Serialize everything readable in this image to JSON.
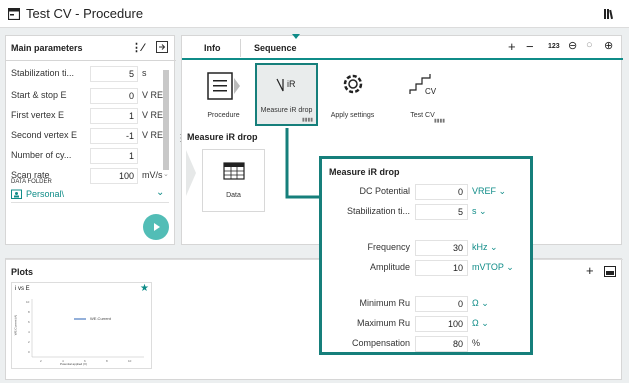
{
  "app": {
    "title": "Test CV - Procedure"
  },
  "main_params": {
    "title": "Main parameters",
    "rows": [
      {
        "label": "Stabilization ti...",
        "value": "5",
        "unit": "s"
      },
      {
        "label": "Start & stop E",
        "value": "0",
        "unit": "V REF"
      },
      {
        "label": "First vertex E",
        "value": "1",
        "unit": "V REF"
      },
      {
        "label": "Second vertex E",
        "value": "-1",
        "unit": "V REF"
      },
      {
        "label": "Number of cy...",
        "value": "1",
        "unit": ""
      },
      {
        "label": "Scan rate",
        "value": "100",
        "unit": "mV/s"
      }
    ],
    "data_folder_label": "DATA FOLDER",
    "data_folder_value": "Personal\\"
  },
  "tabs": {
    "info": "Info",
    "sequence": "Sequence"
  },
  "toolbar": {
    "plus": "+",
    "minus": "−",
    "numbers": "123"
  },
  "sequence": {
    "tiles": [
      {
        "label": "Procedure",
        "icon": "procedure-icon"
      },
      {
        "label": "Measure iR drop",
        "icon": "ir-drop-icon"
      },
      {
        "label": "Apply settings",
        "icon": "gear-icon"
      },
      {
        "label": "Test CV",
        "icon": "cv-icon"
      }
    ],
    "section_title": "Measure iR drop",
    "data_tile": "Data"
  },
  "popup": {
    "title": "Measure iR drop",
    "rows": [
      {
        "label": "DC Potential",
        "value": "0",
        "unit": "VREF"
      },
      {
        "label": "Stabilization ti...",
        "value": "5",
        "unit": "s"
      },
      {
        "label": "Frequency",
        "value": "30",
        "unit": "kHz"
      },
      {
        "label": "Amplitude",
        "value": "10",
        "unit": "mVTOP"
      },
      {
        "label": "Minimum Ru",
        "value": "0",
        "unit": "Ω"
      },
      {
        "label": "Maximum Ru",
        "value": "100",
        "unit": "Ω"
      },
      {
        "label": "Compensation",
        "value": "80",
        "unit": "%"
      }
    ]
  },
  "plots": {
    "title": "Plots",
    "thumb_title": "i vs E",
    "legend": "WE.Current",
    "xlabel": "Potential applied (V)",
    "ylabel": "WE.Current (A)"
  },
  "colors": {
    "accent": "#0f8c88",
    "popup_border": "#167f7b"
  }
}
